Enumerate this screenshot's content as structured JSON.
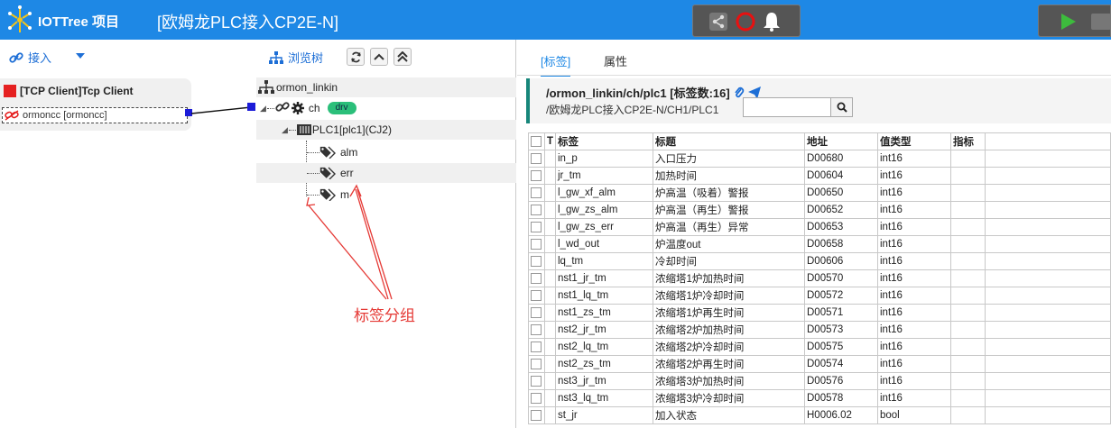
{
  "app": {
    "title": "IOTTree 项目",
    "project_title": "[欧姆龙PLC接入CP2E-N]",
    "colors": {
      "topbar": "#1e88e5",
      "accent": "#1e6fd6",
      "drv_badge": "#2bbf7a",
      "annotation": "#e53935"
    }
  },
  "left_toolbar": {
    "connect_label": "接入",
    "browse_label": "浏览树",
    "icons": [
      "link-icon",
      "caret-down-icon",
      "sitemap-icon",
      "refresh-icon",
      "chevron-up-icon",
      "double-chevron-up-icon"
    ]
  },
  "connection": {
    "title": "[TCP Client]Tcp Client",
    "channel": "ormoncc [ormoncc]"
  },
  "tree": {
    "root": "ormon_linkin",
    "channel": "ch",
    "channel_badge": "drv",
    "device": "PLC1[plc1](CJ2)",
    "groups": [
      "alm",
      "err",
      "m"
    ]
  },
  "annotation": {
    "text": "标签分组"
  },
  "right": {
    "tabs": [
      "[标签]",
      "属性"
    ],
    "path": "/ormon_linkin/ch/plc1 [标签数:16]",
    "subpath": "/欧姆龙PLC接入CP2E-N/CH1/PLC1",
    "search_value": ""
  },
  "table": {
    "columns": [
      "",
      "T",
      "标签",
      "标题",
      "地址",
      "值类型",
      "指标",
      ""
    ],
    "rows": [
      [
        "in_p",
        "入口压力",
        "D00680",
        "int16"
      ],
      [
        "jr_tm",
        "加热时间",
        "D00604",
        "int16"
      ],
      [
        "l_gw_xf_alm",
        "炉高温（吸着）警报",
        "D00650",
        "int16"
      ],
      [
        "l_gw_zs_alm",
        "炉高温（再生）警报",
        "D00652",
        "int16"
      ],
      [
        "l_gw_zs_err",
        "炉高温（再生）异常",
        "D00653",
        "int16"
      ],
      [
        "l_wd_out",
        "炉温度out",
        "D00658",
        "int16"
      ],
      [
        "lq_tm",
        "冷却时间",
        "D00606",
        "int16"
      ],
      [
        "nst1_jr_tm",
        "浓缩塔1炉加热时间",
        "D00570",
        "int16"
      ],
      [
        "nst1_lq_tm",
        "浓缩塔1炉冷却时间",
        "D00572",
        "int16"
      ],
      [
        "nst1_zs_tm",
        "浓缩塔1炉再生时间",
        "D00571",
        "int16"
      ],
      [
        "nst2_jr_tm",
        "浓缩塔2炉加热时间",
        "D00573",
        "int16"
      ],
      [
        "nst2_lq_tm",
        "浓缩塔2炉冷却时间",
        "D00575",
        "int16"
      ],
      [
        "nst2_zs_tm",
        "浓缩塔2炉再生时间",
        "D00574",
        "int16"
      ],
      [
        "nst3_jr_tm",
        "浓缩塔3炉加热时间",
        "D00576",
        "int16"
      ],
      [
        "nst3_lq_tm",
        "浓缩塔3炉冷却时间",
        "D00578",
        "int16"
      ],
      [
        "st_jr",
        "加入状态",
        "H0006.02",
        "bool"
      ]
    ]
  }
}
